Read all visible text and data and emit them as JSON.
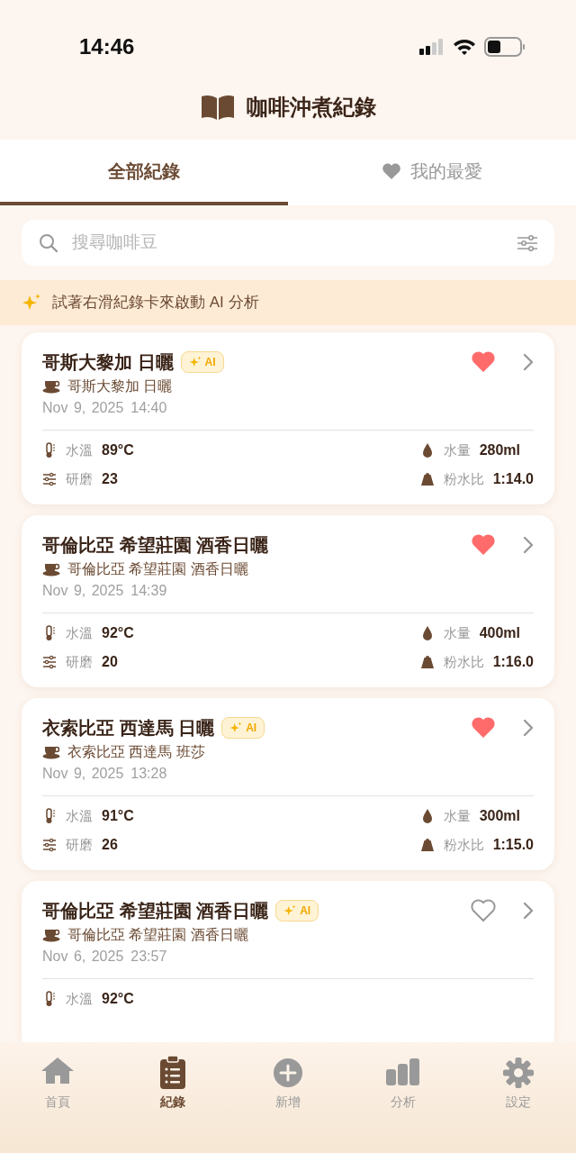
{
  "status_bar": {
    "time": "14:46"
  },
  "header": {
    "title": "咖啡沖煮紀錄"
  },
  "tabs": [
    {
      "kind": "all",
      "label": "全部紀錄",
      "selected": true
    },
    {
      "kind": "favorites",
      "label": "我的最愛",
      "selected": false
    }
  ],
  "search": {
    "placeholder": "搜尋咖啡豆"
  },
  "hint": "試著右滑紀錄卡來啟動 AI 分析",
  "records": [
    {
      "title": "哥斯大黎加 日曬",
      "ai_badge": "AI",
      "favorite": true,
      "bean": "哥斯大黎加 日曬",
      "date": "Nov 9, 2025",
      "time": "14:40",
      "stats": [
        {
          "kind": "temp",
          "label": "水溫",
          "value": "89°C"
        },
        {
          "kind": "water",
          "label": "水量",
          "value": "280ml"
        },
        {
          "kind": "grind",
          "label": "研磨",
          "value": "23"
        },
        {
          "kind": "ratio",
          "label": "粉水比",
          "value": "1:14.0"
        }
      ]
    },
    {
      "title": "哥倫比亞 希望莊園 酒香日曬",
      "favorite": true,
      "bean": "哥倫比亞 希望莊園 酒香日曬",
      "date": "Nov 9, 2025",
      "time": "14:39",
      "stats": [
        {
          "kind": "temp",
          "label": "水溫",
          "value": "92°C"
        },
        {
          "kind": "water",
          "label": "水量",
          "value": "400ml"
        },
        {
          "kind": "grind",
          "label": "研磨",
          "value": "20"
        },
        {
          "kind": "ratio",
          "label": "粉水比",
          "value": "1:16.0"
        }
      ]
    },
    {
      "title": "衣索比亞 西達馬 日曬",
      "ai_badge": "AI",
      "favorite": true,
      "bean": "衣索比亞 西達馬 班莎",
      "date": "Nov 9, 2025",
      "time": "13:28",
      "stats": [
        {
          "kind": "temp",
          "label": "水溫",
          "value": "91°C"
        },
        {
          "kind": "water",
          "label": "水量",
          "value": "300ml"
        },
        {
          "kind": "grind",
          "label": "研磨",
          "value": "26"
        },
        {
          "kind": "ratio",
          "label": "粉水比",
          "value": "1:15.0"
        }
      ]
    },
    {
      "title": "哥倫比亞 希望莊園 酒香日曬",
      "ai_badge": "AI",
      "favorite": false,
      "bean": "哥倫比亞 希望莊園 酒香日曬",
      "date": "Nov 6, 2025",
      "time": "23:57",
      "stats": [
        {
          "kind": "temp",
          "label": "水溫",
          "value": "92°C"
        }
      ]
    }
  ],
  "nav": [
    {
      "kind": "home",
      "label": "首頁",
      "selected": false
    },
    {
      "kind": "records",
      "label": "紀錄",
      "selected": true
    },
    {
      "kind": "add",
      "label": "新增",
      "selected": false
    },
    {
      "kind": "stats",
      "label": "分析",
      "selected": false
    },
    {
      "kind": "settings",
      "label": "設定",
      "selected": false
    }
  ]
}
